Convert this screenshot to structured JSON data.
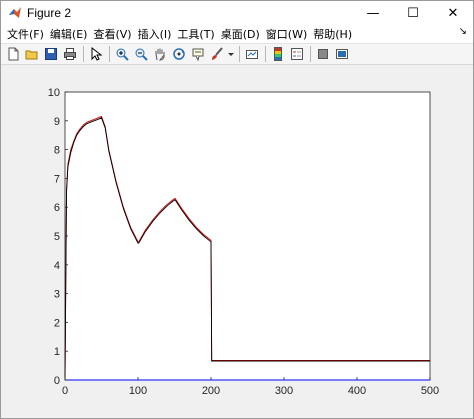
{
  "window": {
    "title": "Figure 2",
    "minimize_glyph": "—",
    "maximize_glyph": "☐",
    "close_glyph": "✕"
  },
  "menu": {
    "items": [
      "文件(F)",
      "编辑(E)",
      "查看(V)",
      "插入(I)",
      "工具(T)",
      "桌面(D)",
      "窗口(W)",
      "帮助(H)"
    ],
    "overflow_glyph": "↘"
  },
  "toolbar": {
    "icons": [
      "new-figure-icon",
      "open-file-icon",
      "save-icon",
      "print-icon",
      "edit-plot-icon",
      "zoom-in-icon",
      "zoom-out-icon",
      "pan-icon",
      "rotate-3d-icon",
      "data-cursor-icon",
      "brush-icon",
      "link-plot-icon",
      "insert-colorbar-icon",
      "insert-legend-icon",
      "hide-plot-tools-icon",
      "show-plot-tools-icon"
    ]
  },
  "colors": {
    "plot_background": "#ffffff",
    "figure_background": "#f0f0f0",
    "series_black": "#000000",
    "series_red": "#d40000",
    "series_blue": "#0000ff"
  },
  "chart_data": {
    "type": "line",
    "xlim": [
      0,
      500
    ],
    "ylim": [
      0,
      10
    ],
    "x_ticks": [
      "0",
      "100",
      "200",
      "300",
      "400",
      "500"
    ],
    "y_ticks": [
      "0",
      "1",
      "2",
      "3",
      "4",
      "5",
      "6",
      "7",
      "8",
      "9",
      "10"
    ],
    "grid": false,
    "series": [
      {
        "color": "#d40000",
        "x": [
          0,
          2,
          4,
          8,
          12,
          16,
          20,
          25,
          30,
          35,
          40,
          45,
          50,
          55,
          60,
          70,
          80,
          90,
          100,
          101,
          110,
          120,
          130,
          140,
          150,
          151,
          160,
          170,
          180,
          190,
          200,
          201,
          300,
          400,
          500
        ],
        "y": [
          0,
          6.6,
          7.5,
          8.0,
          8.3,
          8.55,
          8.7,
          8.85,
          8.95,
          9.0,
          9.05,
          9.1,
          9.15,
          8.8,
          8.0,
          6.9,
          6.0,
          5.3,
          4.8,
          4.8,
          5.2,
          5.55,
          5.85,
          6.1,
          6.3,
          6.3,
          5.95,
          5.6,
          5.3,
          5.05,
          4.85,
          0.68,
          0.68,
          0.68,
          0.68
        ]
      },
      {
        "color": "#000000",
        "x": [
          0,
          2,
          4,
          8,
          12,
          16,
          20,
          25,
          30,
          35,
          40,
          45,
          50,
          55,
          60,
          70,
          80,
          90,
          100,
          101,
          110,
          120,
          130,
          140,
          150,
          151,
          160,
          170,
          180,
          190,
          200,
          201,
          300,
          400,
          500
        ],
        "y": [
          0,
          6.5,
          7.4,
          7.9,
          8.25,
          8.5,
          8.65,
          8.8,
          8.9,
          8.95,
          9.0,
          9.05,
          9.1,
          8.75,
          7.95,
          6.85,
          5.95,
          5.25,
          4.75,
          4.75,
          5.15,
          5.5,
          5.8,
          6.05,
          6.25,
          6.25,
          5.9,
          5.55,
          5.25,
          5.0,
          4.8,
          0.66,
          0.66,
          0.66,
          0.66
        ]
      },
      {
        "color": "#0000ff",
        "x": [
          0,
          500
        ],
        "y": [
          0,
          0
        ]
      }
    ]
  }
}
